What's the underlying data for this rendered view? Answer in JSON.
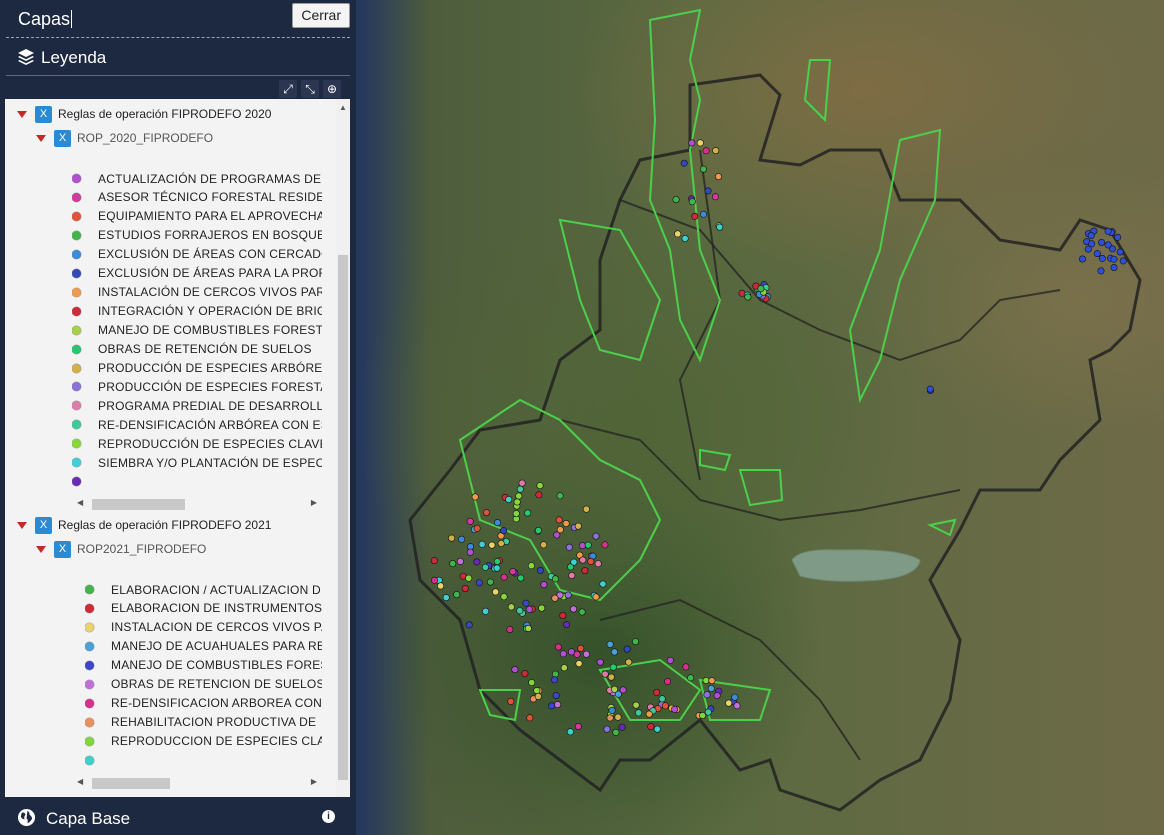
{
  "panel": {
    "title": "Capas",
    "close_label": "Cerrar",
    "legend_title": "Leyenda",
    "base_title": "Capa Base"
  },
  "icons": {
    "layers": "layers-icon",
    "expand": "expand-icon",
    "collapse": "collapse-icon",
    "zoom": "zoom-in-icon",
    "globe": "globe-icon",
    "info": "info-icon",
    "checkbox": "checkbox-x-icon"
  },
  "groups": [
    {
      "label": "Reglas de operación FIPRODEFO 2020",
      "sublayer": "ROP_2020_FIPRODEFO",
      "items": [
        {
          "label": "ACTUALIZACIÓN DE PROGRAMAS DE",
          "color": "#b24fd0"
        },
        {
          "label": "ASESOR TÉCNICO FORESTAL RESIDE",
          "color": "#d23aa0"
        },
        {
          "label": "EQUIPAMIENTO PARA EL APROVECHA",
          "color": "#e0523a"
        },
        {
          "label": "ESTUDIOS FORRAJEROS EN BOSQUES",
          "color": "#3fb54a"
        },
        {
          "label": "EXCLUSIÓN DE ÁREAS CON CERCADO",
          "color": "#3c8ad8"
        },
        {
          "label": "EXCLUSIÓN DE ÁREAS PARA LA PROF",
          "color": "#3049b8"
        },
        {
          "label": "INSTALACIÓN DE CERCOS VIVOS PAR",
          "color": "#f2994a"
        },
        {
          "label": "INTEGRACIÓN Y OPERACIÓN DE BRIG",
          "color": "#cf2a3a"
        },
        {
          "label": "MANEJO DE COMBUSTIBLES FORESTA",
          "color": "#a4d04a"
        },
        {
          "label": "OBRAS DE RETENCIÓN DE SUELOS",
          "color": "#28c66e"
        },
        {
          "label": "PRODUCCIÓN DE ESPECIES ARBÓREA",
          "color": "#d4b04a"
        },
        {
          "label": "PRODUCCIÓN DE ESPECIES FORESTA",
          "color": "#8a72d8"
        },
        {
          "label": "PROGRAMA PREDIAL DE DESARROLL",
          "color": "#e07aa8"
        },
        {
          "label": "RE-DENSIFICACIÓN ARBÓREA CON ES",
          "color": "#3ec99a"
        },
        {
          "label": "REPRODUCCIÓN DE ESPECIES CLAVE",
          "color": "#88d83a"
        },
        {
          "label": "SIEMBRA Y/O PLANTACIÓN DE ESPEC",
          "color": "#3ed0d8"
        },
        {
          "label": "",
          "color": "#6a2ab8"
        }
      ]
    },
    {
      "label": "Reglas de operación FIPRODEFO 2021",
      "sublayer": "ROP2021_FIPRODEFO",
      "items": [
        {
          "label": "ELABORACION / ACTUALIZACION D",
          "color": "#3fb54a"
        },
        {
          "label": "ELABORACION DE INSTRUMENTOS",
          "color": "#cf2a3a"
        },
        {
          "label": "INSTALACION DE CERCOS VIVOS PA",
          "color": "#e8d46a"
        },
        {
          "label": "MANEJO DE ACUAHUALES PARA RE",
          "color": "#4ca0d8"
        },
        {
          "label": "MANEJO DE COMBUSTIBLES FORES",
          "color": "#3a48c8"
        },
        {
          "label": "OBRAS DE RETENCION DE SUELOS",
          "color": "#c070d8"
        },
        {
          "label": "RE-DENSIFICACION ARBOREA CON",
          "color": "#d8308a"
        },
        {
          "label": "REHABILITACION PRODUCTIVA DE",
          "color": "#e89060"
        },
        {
          "label": "REPRODUCCION DE ESPECIES CLA",
          "color": "#7ed83a"
        },
        {
          "label": "",
          "color": "#3ed0c8"
        }
      ]
    }
  ]
}
